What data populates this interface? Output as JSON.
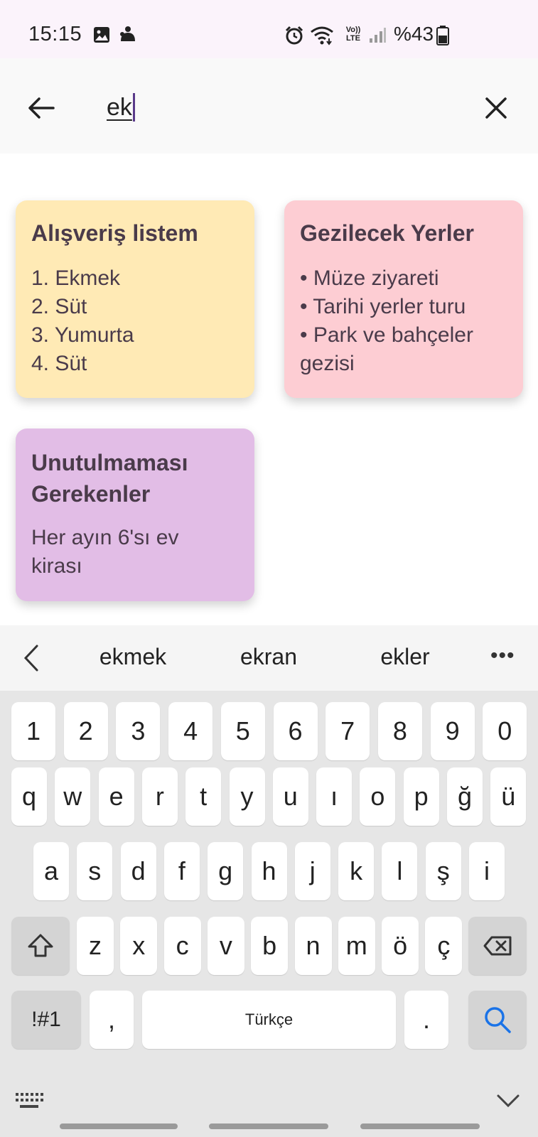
{
  "status_bar": {
    "time": "15:15",
    "battery": "%43",
    "icons": [
      "image-icon",
      "notification-icon",
      "alarm-icon",
      "wifi-icon",
      "volte-icon",
      "signal-icon",
      "battery-icon"
    ],
    "network_label": "VoLTE"
  },
  "search": {
    "query": "ek",
    "back_icon": "arrow-left-icon",
    "clear_icon": "close-icon"
  },
  "notes": [
    {
      "title": "Alışveriş listem",
      "lines": [
        "1. Ekmek",
        "2. Süt",
        "3. Yumurta",
        "4. Süt"
      ],
      "color": "#ffeab5"
    },
    {
      "title": "Gezilecek Yerler",
      "lines": [
        "• Müze ziyareti",
        "• Tarihi yerler turu",
        "• Park ve bahçeler",
        "gezisi"
      ],
      "color": "#fdcdd3"
    },
    {
      "title_lines": [
        "Unutulmaması",
        "Gerekenler"
      ],
      "lines": [
        "Her ayın 6'sı ev",
        "kirası"
      ],
      "color": "#e2bde6"
    }
  ],
  "suggestions": {
    "items": [
      "ekmek",
      "ekran",
      "ekler"
    ],
    "more": "•••"
  },
  "keyboard": {
    "row_numbers": [
      "1",
      "2",
      "3",
      "4",
      "5",
      "6",
      "7",
      "8",
      "9",
      "0"
    ],
    "row_1": [
      "q",
      "w",
      "e",
      "r",
      "t",
      "y",
      "u",
      "ı",
      "o",
      "p",
      "ğ",
      "ü"
    ],
    "row_2": [
      "a",
      "s",
      "d",
      "f",
      "g",
      "h",
      "j",
      "k",
      "l",
      "ş",
      "i"
    ],
    "row_3": [
      "z",
      "x",
      "c",
      "v",
      "b",
      "n",
      "m",
      "ö",
      "ç"
    ],
    "symbols_key": "!#1",
    "comma_key": ",",
    "space_label": "Türkçe",
    "period_key": ".",
    "accent_color": "#1a73e8"
  }
}
